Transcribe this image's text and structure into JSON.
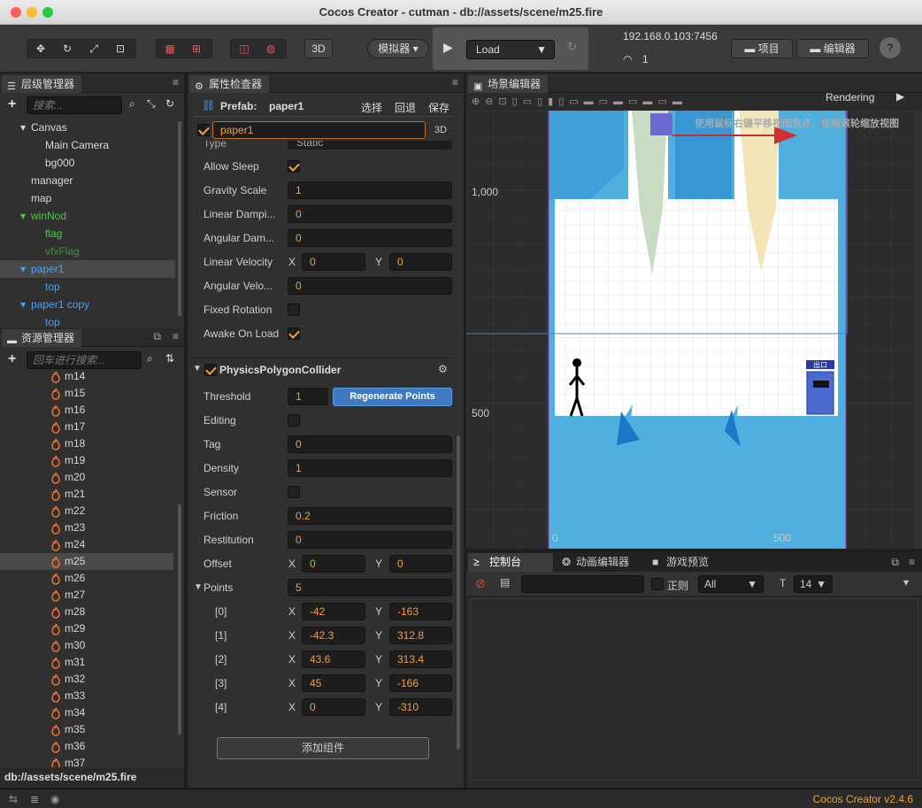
{
  "window": {
    "title": "Cocos Creator - cutman - db://assets/scene/m25.fire"
  },
  "toolbar": {
    "mode_3d": "3D",
    "simulator": "模拟器",
    "load": "Load",
    "ip": "192.168.0.103:7456",
    "device_count": "1",
    "project_btn": "项目",
    "editor_btn": "编辑器"
  },
  "hierarchy": {
    "title": "层级管理器",
    "search_placeholder": "搜索...",
    "nodes": [
      {
        "label": "Canvas",
        "color": "#d8d8d8",
        "indent": 35,
        "arrow": true
      },
      {
        "label": "Main Camera",
        "color": "#d8d8d8",
        "indent": 51,
        "arrow": false
      },
      {
        "label": "bg000",
        "color": "#d8d8d8",
        "indent": 51,
        "arrow": false
      },
      {
        "label": "manager",
        "color": "#d8d8d8",
        "indent": 35,
        "arrow": false
      },
      {
        "label": "map",
        "color": "#d8d8d8",
        "indent": 35,
        "arrow": false
      },
      {
        "label": "winNod",
        "color": "#4ec94e",
        "indent": 35,
        "arrow": true
      },
      {
        "label": "flag",
        "color": "#4ec94e",
        "indent": 51,
        "arrow": false
      },
      {
        "label": "vfxFlag",
        "color": "#3f8f3f",
        "indent": 51,
        "arrow": false
      },
      {
        "label": "paper1",
        "color": "#4aa0f0",
        "indent": 35,
        "arrow": true,
        "selected": true
      },
      {
        "label": "top",
        "color": "#4aa0f0",
        "indent": 51,
        "arrow": false
      },
      {
        "label": "paper1 copy",
        "color": "#4aa0f0",
        "indent": 35,
        "arrow": true
      },
      {
        "label": "top",
        "color": "#4aa0f0",
        "indent": 51,
        "arrow": false
      }
    ]
  },
  "assets": {
    "title": "资源管理器",
    "search_placeholder": "回车进行搜索...",
    "items": [
      "m14",
      "m15",
      "m16",
      "m17",
      "m18",
      "m19",
      "m20",
      "m21",
      "m22",
      "m23",
      "m24",
      "m25",
      "m26",
      "m27",
      "m28",
      "m29",
      "m30",
      "m31",
      "m32",
      "m33",
      "m34",
      "m35",
      "m36",
      "m37"
    ],
    "selected": "m25",
    "path": "db://assets/scene/m25.fire"
  },
  "inspector": {
    "title": "属性检查器",
    "prefab_label": "Prefab:",
    "prefab_name": "paper1",
    "select": "选择",
    "revert": "回退",
    "save": "保存",
    "node_name": "paper1",
    "badge_3d": "3D",
    "type_label": "Type",
    "type_value": "Static",
    "rigid": [
      {
        "label": "Allow Sleep",
        "kind": "check",
        "checked": true
      },
      {
        "label": "Gravity Scale",
        "kind": "num",
        "value": "1"
      },
      {
        "label": "Linear Dampi...",
        "kind": "num",
        "value": "0"
      },
      {
        "label": "Angular Dam...",
        "kind": "num",
        "value": "0"
      },
      {
        "label": "Linear Velocity",
        "kind": "xy",
        "x": "0",
        "y": "0"
      },
      {
        "label": "Angular Velo...",
        "kind": "num",
        "value": "0"
      },
      {
        "label": "Fixed Rotation",
        "kind": "check",
        "checked": false
      },
      {
        "label": "Awake On Load",
        "kind": "check",
        "checked": true
      }
    ],
    "collider_title": "PhysicsPolygonCollider",
    "threshold_label": "Threshold",
    "threshold_value": "1",
    "regen_label": "Regenerate Points",
    "collider": [
      {
        "label": "Editing",
        "kind": "check",
        "checked": false
      },
      {
        "label": "Tag",
        "kind": "num",
        "value": "0"
      },
      {
        "label": "Density",
        "kind": "num",
        "value": "1"
      },
      {
        "label": "Sensor",
        "kind": "check",
        "checked": false
      },
      {
        "label": "Friction",
        "kind": "num",
        "value": "0.2"
      },
      {
        "label": "Restitution",
        "kind": "num",
        "value": "0"
      },
      {
        "label": "Offset",
        "kind": "xy",
        "x": "0",
        "y": "0"
      }
    ],
    "points_label": "Points",
    "points_count": "5",
    "points": [
      {
        "idx": "[0]",
        "x": "-42",
        "y": "-163"
      },
      {
        "idx": "[1]",
        "x": "-42.3",
        "y": "312.8"
      },
      {
        "idx": "[2]",
        "x": "43.6",
        "y": "313.4"
      },
      {
        "idx": "[3]",
        "x": "45",
        "y": "-166"
      },
      {
        "idx": "[4]",
        "x": "0",
        "y": "-310"
      }
    ],
    "x_label": "X",
    "y_label": "Y",
    "add_component": "添加组件"
  },
  "scene": {
    "title": "场景编辑器",
    "rendering": "Rendering",
    "hint": "使用鼠标右键平移视图焦点，使用滚轮缩放视图",
    "ruler_1000": "1,000",
    "ruler_500": "500",
    "axis_0": "0",
    "axis_500": "500",
    "exit_sign": "出口"
  },
  "console": {
    "tabs": [
      "控制台",
      "动画编辑器",
      "游戏预览"
    ],
    "regex_label": "正则",
    "level": "All",
    "font_size": "14"
  },
  "footer": {
    "version": "Cocos Creator v2.4.6"
  }
}
